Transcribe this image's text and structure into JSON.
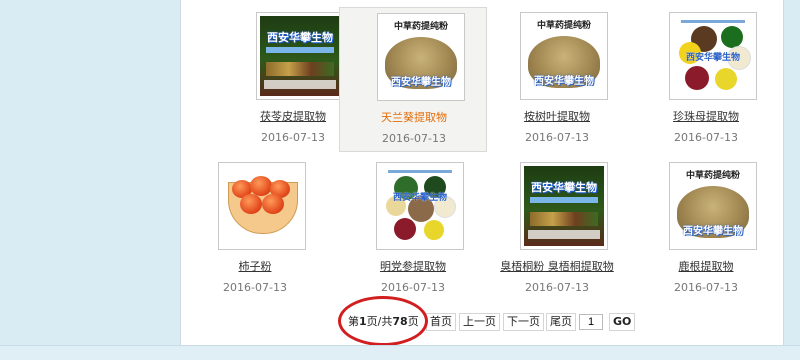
{
  "products": [
    {
      "name": "茯苓皮提取物",
      "date": "2016-07-13",
      "thumb_text": "西安华攀生物"
    },
    {
      "name": "天兰葵提取物",
      "date": "2016-07-13",
      "thumb_text": "中草药提纯粉",
      "thumb_watermark": "西安华攀生物"
    },
    {
      "name": "桉树叶提取物",
      "date": "2016-07-13",
      "thumb_text": "中草药提纯粉",
      "thumb_watermark": "西安华攀生物"
    },
    {
      "name": "珍珠母提取物",
      "date": "2016-07-13",
      "thumb_watermark": "西安华攀生物"
    },
    {
      "name": "柿子粉",
      "date": "2016-07-13"
    },
    {
      "name": "明党参提取物",
      "date": "2016-07-13",
      "thumb_watermark": "西安华攀生物"
    },
    {
      "name": "臭梧桐粉 臭梧桐提取物",
      "date": "2016-07-13",
      "thumb_text": "西安华攀生物"
    },
    {
      "name": "鹿根提取物",
      "date": "2016-07-13",
      "thumb_text": "中草药提纯粉",
      "thumb_watermark": "西安华攀生物"
    }
  ],
  "pagination": {
    "status_prefix": "第",
    "current_page": "1",
    "status_mid": "页/共",
    "total_pages": "78",
    "status_suffix": "页",
    "first": "首页",
    "prev": "上一页",
    "next": "下一页",
    "last": "尾页",
    "page_input_value": "1",
    "go": "GO"
  },
  "colors": {
    "selected_name": "#e36c0a",
    "annotation_ring": "#d21e1e",
    "page_bg": "#d9ecf3"
  }
}
